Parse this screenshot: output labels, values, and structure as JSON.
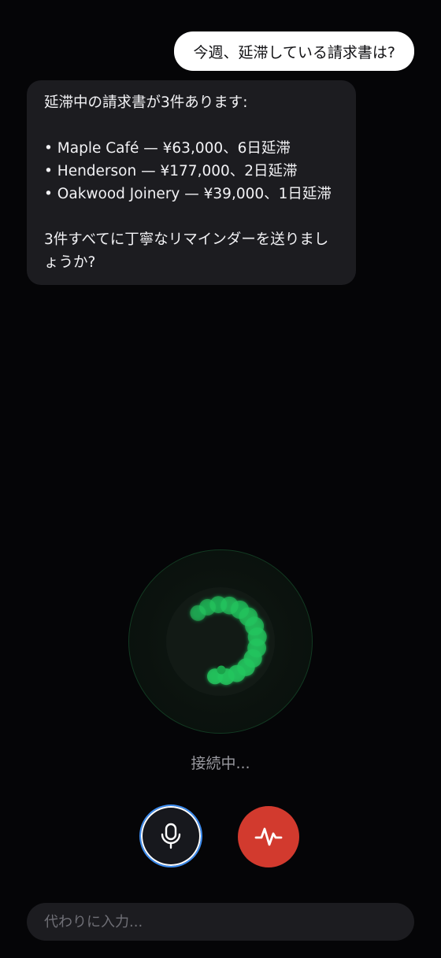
{
  "chat": {
    "user_message": "今週、延滞している請求書は?",
    "assistant": {
      "intro": "延滞中の請求書が3件あります:",
      "items": [
        "• Maple Café — ¥63,000、6日延滞",
        "• Henderson — ¥177,000、2日延滞",
        "• Oakwood Joinery — ¥39,000、1日延滞"
      ],
      "question": "3件すべてに丁寧なリマインダーを送りましょうか?"
    }
  },
  "voice": {
    "status": "接続中...",
    "mic_icon": "microphone-icon",
    "end_icon": "waveform-icon",
    "accent_color": "#22c55e",
    "end_color": "#d23a2e"
  },
  "composer": {
    "placeholder": "代わりに入力..."
  }
}
